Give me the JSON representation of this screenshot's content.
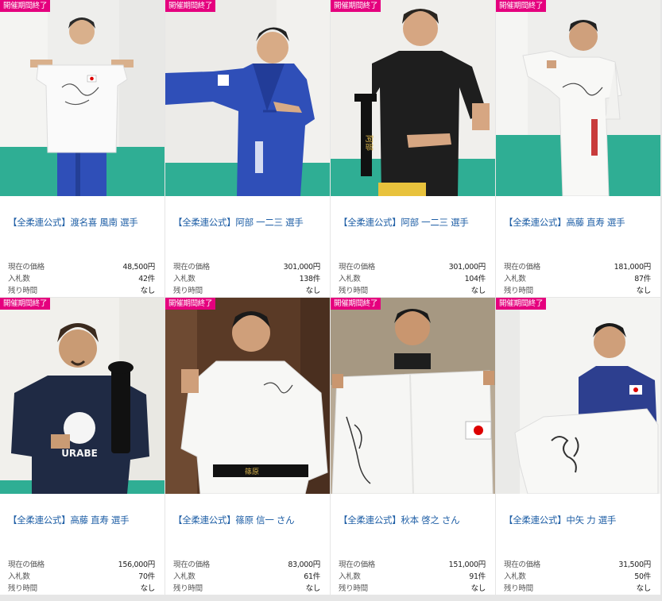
{
  "listing": {
    "items": [
      {
        "badge": "開催期間終了",
        "title": "【全柔連公式】渡名喜 風南 選手",
        "price_label": "現在の価格",
        "price": "48,500円",
        "bids_label": "入札数",
        "bids": "42件",
        "time_label": "残り時間",
        "time": "なし"
      },
      {
        "badge": "開催期間終了",
        "title": "【全柔連公式】阿部 一二三 選手",
        "price_label": "現在の価格",
        "price": "301,000円",
        "bids_label": "入札数",
        "bids": "138件",
        "time_label": "残り時間",
        "time": "なし"
      },
      {
        "badge": "開催期間終了",
        "title": "【全柔連公式】阿部 一二三 選手",
        "price_label": "現在の価格",
        "price": "301,000円",
        "bids_label": "入札数",
        "bids": "104件",
        "time_label": "残り時間",
        "time": "なし"
      },
      {
        "badge": "開催期間終了",
        "title": "【全柔連公式】高藤 直寿 選手",
        "price_label": "現在の価格",
        "price": "181,000円",
        "bids_label": "入札数",
        "bids": "87件",
        "time_label": "残り時間",
        "time": "なし"
      },
      {
        "badge": "開催期間終了",
        "title": "【全柔連公式】高藤 直寿 選手",
        "price_label": "現在の価格",
        "price": "156,000円",
        "bids_label": "入札数",
        "bids": "70件",
        "time_label": "残り時間",
        "time": "なし"
      },
      {
        "badge": "開催期間終了",
        "title": "【全柔連公式】篠原 信一 さん",
        "price_label": "現在の価格",
        "price": "83,000円",
        "bids_label": "入札数",
        "bids": "61件",
        "time_label": "残り時間",
        "time": "なし"
      },
      {
        "badge": "開催期間終了",
        "title": "【全柔連公式】秋本 啓之 さん",
        "price_label": "現在の価格",
        "price": "151,000円",
        "bids_label": "入札数",
        "bids": "91件",
        "time_label": "残り時間",
        "time": "なし"
      },
      {
        "badge": "開催期間終了",
        "title": "【全柔連公式】中矢 力 選手",
        "price_label": "現在の価格",
        "price": "31,500円",
        "bids_label": "入札数",
        "bids": "50件",
        "time_label": "残り時間",
        "time": "なし"
      }
    ]
  },
  "colors": {
    "badge": "#e5007e",
    "title_link": "#1f5fa6",
    "mat_green": "#2fae94",
    "judogi_blue": "#2f4fb8"
  }
}
